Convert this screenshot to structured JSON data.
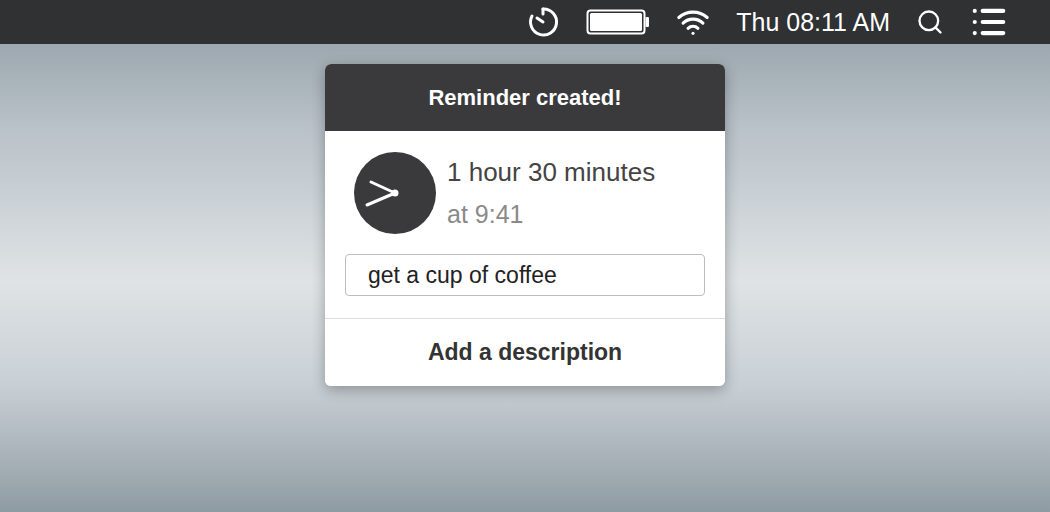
{
  "menu_bar": {
    "clock": "Thu 08:11 AM",
    "battery": {
      "level": 1
    }
  },
  "popup": {
    "title": "Reminder created!",
    "duration": "1 hour 30 minutes",
    "time": "at 9:41",
    "reminder_text": "get a cup of coffee",
    "description_button": "Add a description"
  }
}
